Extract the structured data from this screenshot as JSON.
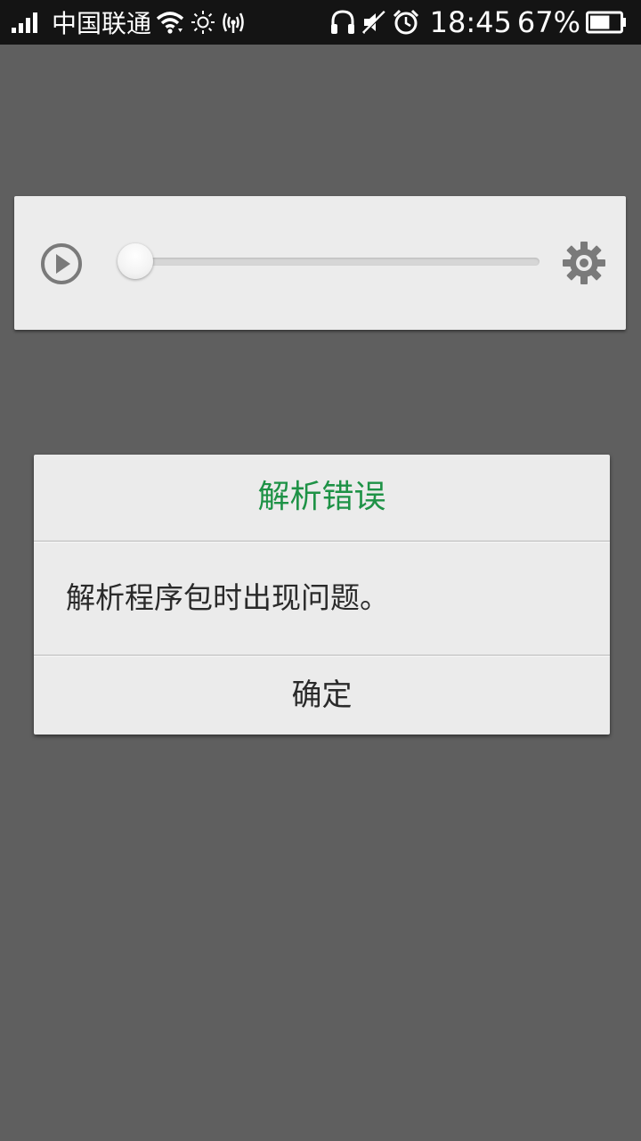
{
  "status_bar": {
    "carrier": "中国联通",
    "time": "18:45",
    "battery_percent": "67%",
    "battery_level": 0.67,
    "icons_left": [
      "signal-icon",
      "wifi-icon",
      "brightness-icon",
      "hotspot-icon"
    ],
    "icons_right": [
      "headphones-icon",
      "mute-icon",
      "alarm-icon",
      "battery-icon"
    ]
  },
  "player": {
    "progress": 0,
    "icons": [
      "play-icon",
      "gear-icon"
    ]
  },
  "dialog": {
    "title": "解析错误",
    "message": "解析程序包时出现问题。",
    "ok_label": "确定",
    "title_color": "#1e9246"
  }
}
